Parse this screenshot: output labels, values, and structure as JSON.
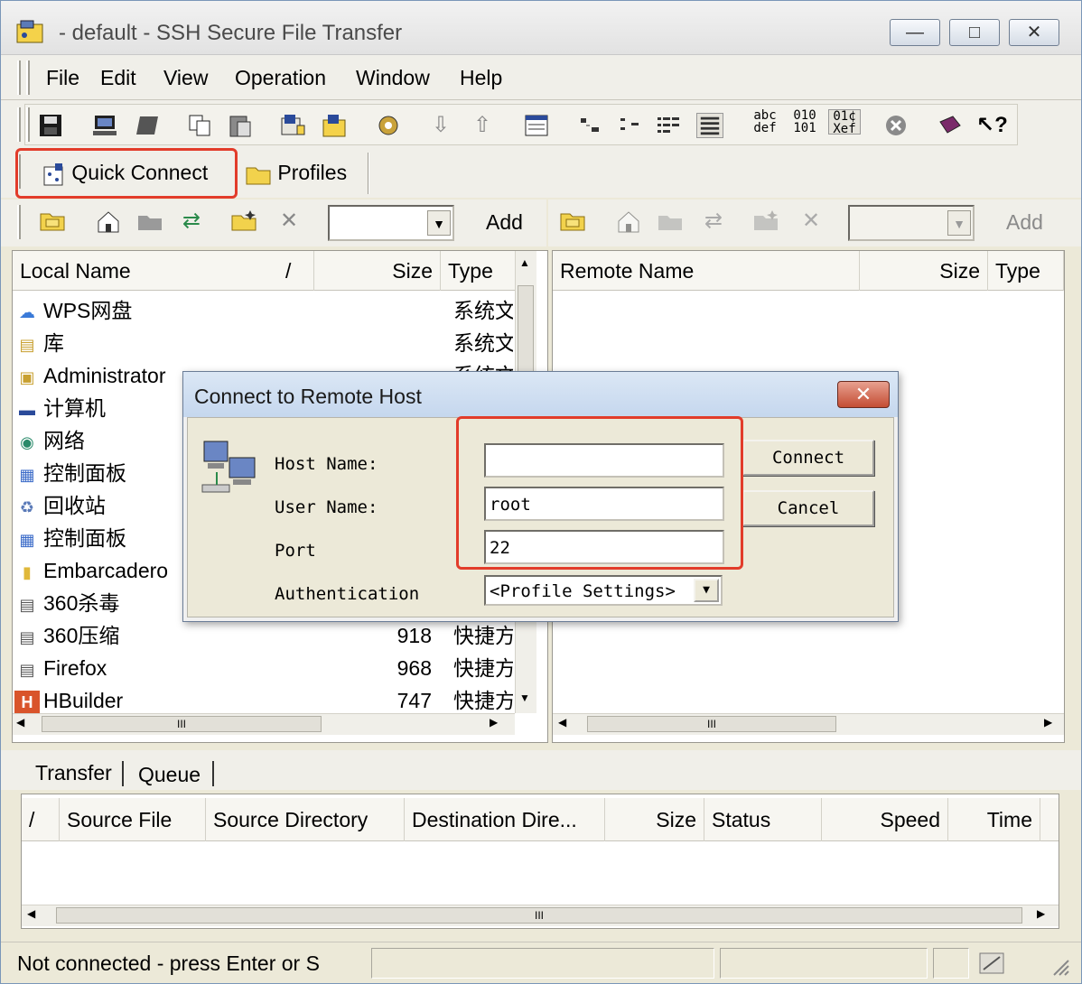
{
  "window": {
    "title": " - default - SSH Secure File Transfer",
    "controls": {
      "minimize": "—",
      "maximize": "□",
      "close": "✕"
    }
  },
  "menu": [
    "File",
    "Edit",
    "View",
    "Operation",
    "Window",
    "Help"
  ],
  "toolbar": {
    "icons": [
      "save-icon",
      "new-terminal-icon",
      "new-file-transfer-icon",
      "copy-icon",
      "paste-icon",
      "connect-icon",
      "disconnect-icon",
      "settings-icon",
      "download-icon",
      "upload-icon",
      "window-layout-icon",
      "large-icons-icon",
      "small-icons-icon",
      "list-icon",
      "details-icon",
      "ascii-mode-icon",
      "binary-mode-icon",
      "auto-mode-icon",
      "stop-icon",
      "help-book-icon",
      "context-help-icon"
    ],
    "ascii_text": "abc def",
    "binary_text": "010 101",
    "auto_text": "01¢ Xef"
  },
  "quick_connect": {
    "label": "Quick Connect",
    "profiles_label": "Profiles"
  },
  "local_toolbar": {
    "add_label": "Add",
    "combo_value": ""
  },
  "remote_toolbar": {
    "add_label": "Add",
    "combo_value": ""
  },
  "local_pane": {
    "columns": {
      "name": "Local Name",
      "sort_indicator": "/",
      "size": "Size",
      "type": "Type"
    },
    "rows": [
      {
        "name": "WPS网盘",
        "size": "",
        "type": "系统文",
        "icon": "cloud-icon"
      },
      {
        "name": "库",
        "size": "",
        "type": "系统文",
        "icon": "library-folder-icon"
      },
      {
        "name": "Administrator",
        "size": "",
        "type": "系统文",
        "icon": "user-folder-icon"
      },
      {
        "name": "计算机",
        "size": "",
        "type": "",
        "icon": "computer-icon"
      },
      {
        "name": "网络",
        "size": "",
        "type": "",
        "icon": "network-icon"
      },
      {
        "name": "控制面板",
        "size": "",
        "type": "",
        "icon": "control-panel-icon"
      },
      {
        "name": "回收站",
        "size": "",
        "type": "",
        "icon": "recycle-bin-icon"
      },
      {
        "name": "控制面板",
        "size": "",
        "type": "",
        "icon": "control-panel-icon"
      },
      {
        "name": "Embarcadero",
        "size": "",
        "type": "",
        "icon": "folder-icon"
      },
      {
        "name": "360杀毒",
        "size": "",
        "type": "",
        "icon": "shortcut-icon"
      },
      {
        "name": "360压缩",
        "size": "918",
        "type": "快捷方",
        "icon": "shortcut-icon"
      },
      {
        "name": "Firefox",
        "size": "968",
        "type": "快捷方",
        "icon": "shortcut-icon"
      },
      {
        "name": "HBuilder",
        "size": "747",
        "type": "快捷方",
        "icon": "hbuilder-icon"
      }
    ]
  },
  "remote_pane": {
    "columns": {
      "name": "Remote Name",
      "size": "Size",
      "type": "Type"
    }
  },
  "dialog": {
    "title": "Connect to Remote Host",
    "close": "✕",
    "labels": {
      "host": "Host Name:",
      "user": "User Name:",
      "port": "Port",
      "auth": "Authentication"
    },
    "values": {
      "host": "",
      "user": "root",
      "port": "22",
      "auth": "<Profile Settings>"
    },
    "buttons": {
      "connect": "Connect",
      "cancel": "Cancel"
    }
  },
  "transfer": {
    "tabs": [
      "Transfer",
      "Queue"
    ],
    "columns": [
      "/",
      "Source File",
      "Source Directory",
      "Destination Dire...",
      "Size",
      "Status",
      "Speed",
      "Time"
    ]
  },
  "status": {
    "text": "Not connected - press Enter or S"
  },
  "scroll_glyph": "III",
  "highlight_color": "#e23c2a"
}
